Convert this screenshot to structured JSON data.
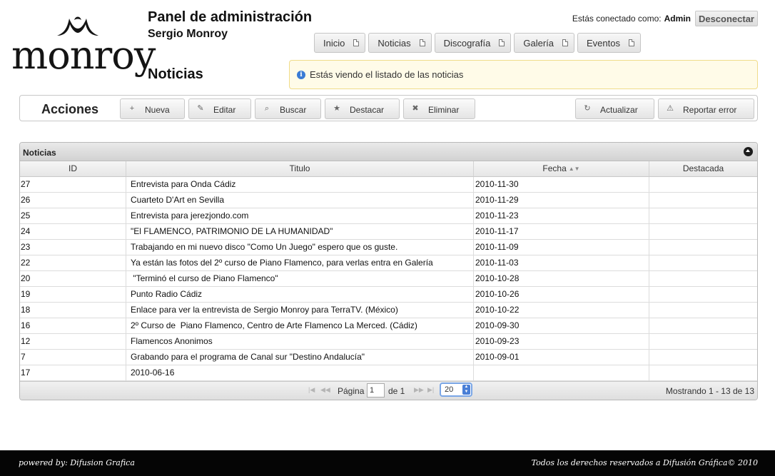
{
  "brand": {
    "logo_text": "monroy"
  },
  "header": {
    "panel_title": "Panel de administración",
    "panel_subtitle": "Sergio Monroy",
    "section_title": "Noticias",
    "connected_label": "Estás conectado como:",
    "username": "Admin",
    "logout_label": "Desconectar"
  },
  "nav": {
    "items": [
      {
        "label": "Inicio"
      },
      {
        "label": "Noticias"
      },
      {
        "label": "Discografía"
      },
      {
        "label": "Galería"
      },
      {
        "label": "Eventos"
      }
    ]
  },
  "info": {
    "message": "Estás viendo el listado de las noticias"
  },
  "actions": {
    "title": "Acciones",
    "buttons": {
      "nueva": "Nueva",
      "editar": "Editar",
      "buscar": "Buscar",
      "destacar": "Destacar",
      "eliminar": "Eliminar",
      "actualizar": "Actualizar",
      "reportar": "Reportar error"
    }
  },
  "grid": {
    "caption": "Noticias",
    "columns": [
      "ID",
      "Titulo",
      "Fecha",
      "Destacada"
    ],
    "rows": [
      {
        "id": "27",
        "title": "Entrevista para Onda Cádiz",
        "date": "2010-11-30",
        "featured": ""
      },
      {
        "id": "26",
        "title": "Cuarteto D'Art en Sevilla",
        "date": "2010-11-29",
        "featured": ""
      },
      {
        "id": "25",
        "title": "Entrevista para jerezjondo.com",
        "date": "2010-11-23",
        "featured": ""
      },
      {
        "id": "24",
        "title": "\"El FLAMENCO, PATRIMONIO DE LA HUMANIDAD\"",
        "date": "2010-11-17",
        "featured": ""
      },
      {
        "id": "23",
        "title": "Trabajando en mi nuevo disco \"Como Un Juego\" espero que os guste.",
        "date": "2010-11-09",
        "featured": ""
      },
      {
        "id": "22",
        "title": "Ya están las fotos del 2º curso de Piano Flamenco, para verlas entra en Galería",
        "date": "2010-11-03",
        "featured": ""
      },
      {
        "id": "20",
        "title": " \"Terminó el curso de Piano Flamenco\"",
        "date": "2010-10-28",
        "featured": ""
      },
      {
        "id": "19",
        "title": "Punto Radio Cádiz",
        "date": "2010-10-26",
        "featured": ""
      },
      {
        "id": "18",
        "title": "Enlace para ver la entrevista de Sergio Monroy para TerraTV. (México)",
        "date": "2010-10-22",
        "featured": ""
      },
      {
        "id": "16",
        "title": "2º Curso de  Piano Flamenco, Centro de Arte Flamenco La Merced. (Cádiz)",
        "date": "2010-09-30",
        "featured": ""
      },
      {
        "id": "12",
        "title": "Flamencos Anonimos",
        "date": "2010-09-23",
        "featured": ""
      },
      {
        "id": "7",
        "title": "Grabando para el programa de Canal sur \"Destino Andalucía\"",
        "date": "2010-09-01",
        "featured": ""
      },
      {
        "id": "17",
        "title": "2010-06-16",
        "date": "",
        "featured": ""
      }
    ]
  },
  "pager": {
    "page_label": "Página",
    "page_value": "1",
    "of_label": "de 1",
    "rows_per_page": "20",
    "showing": "Mostrando 1 - 13 de 13"
  },
  "footer": {
    "left": "powered by: Difusion Grafica",
    "right": "Todos los derechos reservados a Difusión Gráfica© 2010"
  }
}
